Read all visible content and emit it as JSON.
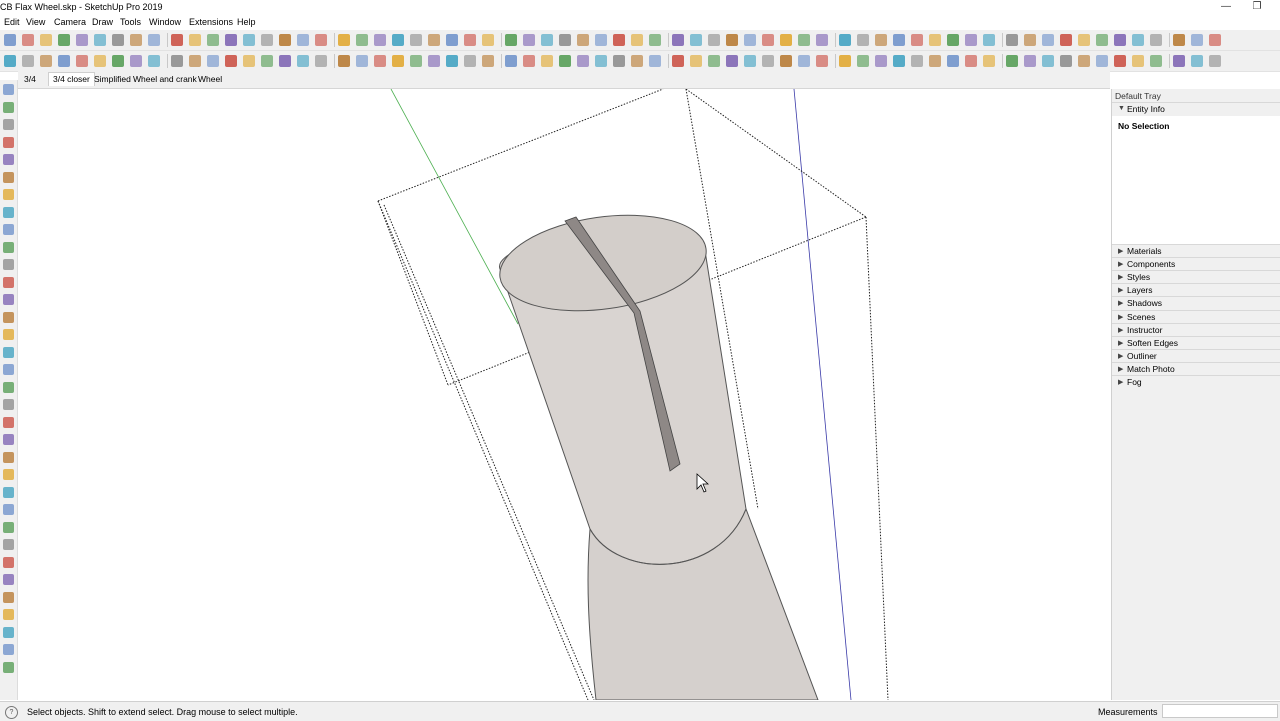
{
  "window": {
    "title": "CB Flax Wheel.skp - SketchUp Pro 2019",
    "minimize_glyph": "—",
    "restore_glyph": "❐"
  },
  "menu": [
    "Edit",
    "View",
    "Camera",
    "Draw",
    "Tools",
    "Window",
    "Extensions",
    "Help"
  ],
  "scene_tabs": [
    {
      "label": "3/4",
      "active": false
    },
    {
      "label": "3/4 closer",
      "active": true
    },
    {
      "label": "Simplified",
      "active": false
    },
    {
      "label": "Wheel and crank",
      "active": false
    },
    {
      "label": "Wheel",
      "active": false
    }
  ],
  "toolbar_icons": [
    "select-icon",
    "paint-bucket-icon",
    "eraser-icon",
    "tape-measure-icon",
    "rotate-icon",
    "move-icon",
    "undo-icon",
    "redo-icon",
    "print-icon",
    "model-info-icon",
    "components-icon",
    "home-icon",
    "iso-view-icon",
    "top-view-icon",
    "front-view-icon",
    "right-view-icon",
    "back-view-icon",
    "left-view-icon",
    "bottom-view-icon",
    "xray-icon",
    "wireframe-icon",
    "hidden-line-icon",
    "shaded-icon",
    "textured-icon",
    "monochrome-icon",
    "warehouse-icon",
    "extension-icon",
    "styles-icon",
    "section-plane-icon",
    "orbit-icon",
    "pan-icon",
    "zoom-icon",
    "zoom-window-icon",
    "zoom-extents-icon",
    "previous-view-icon",
    "walk-icon",
    "look-around-icon",
    "position-camera-icon"
  ],
  "tray": {
    "title": "Default Tray",
    "entity_info": {
      "label": "Entity Info",
      "selection": "No Selection"
    },
    "panels": [
      "Materials",
      "Components",
      "Styles",
      "Layers",
      "Shadows",
      "Scenes",
      "Instructor",
      "Soften Edges",
      "Outliner",
      "Match Photo",
      "Fog"
    ],
    "expanded_arrow": "▼",
    "collapsed_arrow": "▶"
  },
  "status": {
    "hint": "Select objects. Shift to extend select. Drag mouse to select multiple.",
    "measurements_label": "Measurements",
    "measurements_value": "",
    "icon_glyph": "?"
  },
  "colors": {
    "model_face": "#d8d3d0",
    "model_shadow": "#8e8886",
    "axis_green": "#4caf50",
    "axis_blue": "#3a3aa8"
  }
}
